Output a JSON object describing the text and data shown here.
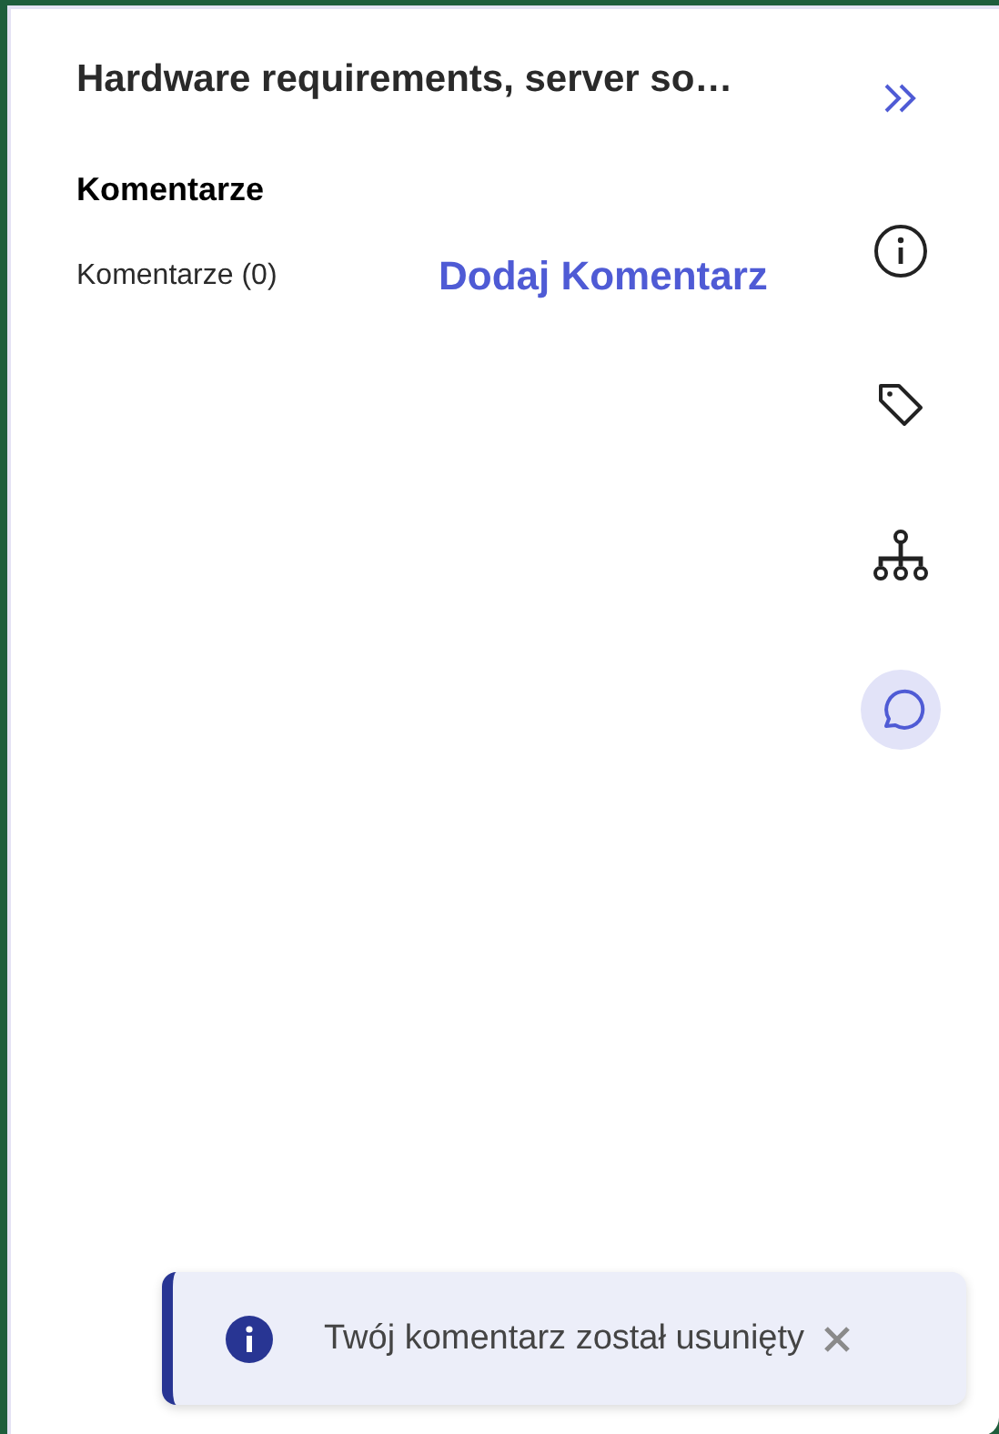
{
  "panel": {
    "title": "Hardware requirements, server so…",
    "section_heading": "Komentarze",
    "comment_count": "Komentarze (0)",
    "add_link": "Dodaj Komentarz"
  },
  "rail": [
    {
      "kind": "info",
      "selected": false
    },
    {
      "kind": "tag",
      "selected": false
    },
    {
      "kind": "hierarchy",
      "selected": false
    },
    {
      "kind": "comment",
      "selected": true
    }
  ],
  "toast": {
    "message": "Twój komentarz został usunięty"
  }
}
